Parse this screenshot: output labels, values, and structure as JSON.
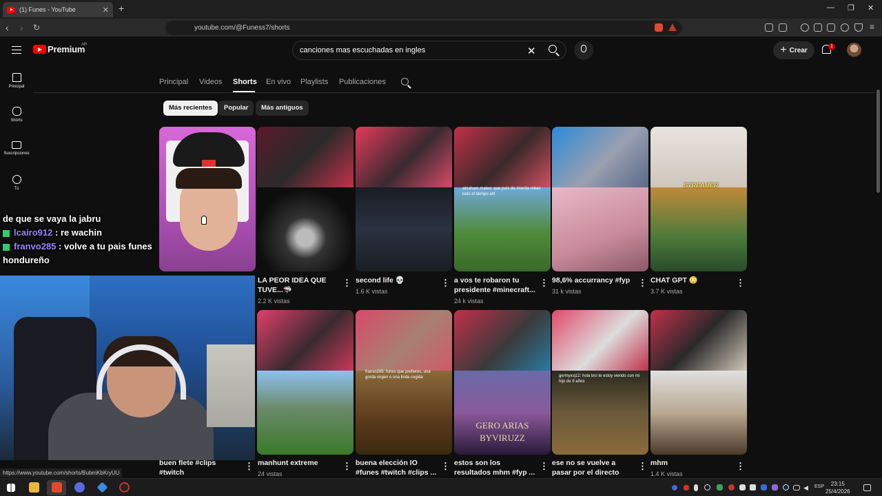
{
  "browser": {
    "tab_title": "(1) Funes - YouTube",
    "url": "youtube.com/@Funess7/shorts",
    "status_url": "https://www.youtube.com/shorts/BubmKbKryUU"
  },
  "header": {
    "logo_text": "Premium",
    "country": "AR",
    "search_value": "canciones mas escuchadas en ingles",
    "create_label": "Crear",
    "notification_count": "1"
  },
  "sidebar": {
    "items": [
      {
        "label": "Principal",
        "icon": "home-icon"
      },
      {
        "label": "Shorts",
        "icon": "shorts-icon"
      },
      {
        "label": "Suscripciones",
        "icon": "subscriptions-icon"
      },
      {
        "label": "Tú",
        "icon": "you-icon"
      }
    ]
  },
  "channel_tabs": [
    "Principal",
    "Videos",
    "Shorts",
    "En vivo",
    "Playlists",
    "Publicaciones"
  ],
  "active_tab": "Shorts",
  "chips": [
    "Más recientes",
    "Popular",
    "Más antiguos"
  ],
  "shorts": [
    {
      "title": "",
      "views": ""
    },
    {
      "title": "LA PEOR IDEA QUE TUVE...🦈",
      "views": "2.2 K vistas"
    },
    {
      "title": "second life 💀",
      "views": "1.6 K vistas"
    },
    {
      "title": "a vos te robaron tu presidente #minecraft...",
      "views": "24 k vistas"
    },
    {
      "title": "98,6% accurrancy #fyp",
      "views": "31 k vistas"
    },
    {
      "title": "CHAT GPT 😳",
      "views": "3.7 K vistas"
    },
    {
      "title": "buen flete #clips #twitch",
      "views": ""
    },
    {
      "title": "manhunt extreme",
      "views": "24 vistas"
    },
    {
      "title": "buena elección IO #funes #twitch #clips ...",
      "views": ""
    },
    {
      "title": "estos son los resultados mhm #fyp ...",
      "views": ""
    },
    {
      "title": "ese no se vuelve a pasar por el directo LO...",
      "views": ""
    },
    {
      "title": "mhm",
      "views": "1.4 K vistas"
    }
  ],
  "thumb_captions": {
    "streamer": "STREAMER",
    "abraham": "abraham mateo: que país de mierda roban todo el tiempo ahí",
    "franvo": "franvo285: funes que prefieres, una gorda virgen o una linda cogida",
    "gero_line1": "GERO ARIAS",
    "gero_line2": "BYVIRUZZ",
    "germyxsj": "germyxsj12: hola bro te estoy viendo con mi hijo de 9 años"
  },
  "chat": [
    {
      "user": "",
      "message": "de que se vaya la jabru"
    },
    {
      "user": "lcairo912",
      "message": ": re wachin"
    },
    {
      "user": "franvo285",
      "message": ": volve a tu pais funes hondureño"
    }
  ],
  "taskbar": {
    "language": "ESP",
    "time": "23:15",
    "date": "25/4/2026"
  },
  "colors": {
    "background": "#0f0f0f",
    "accent_red": "#ff0000",
    "chat_username": "#9b84ff",
    "chip_active": "#f1f1f1"
  }
}
